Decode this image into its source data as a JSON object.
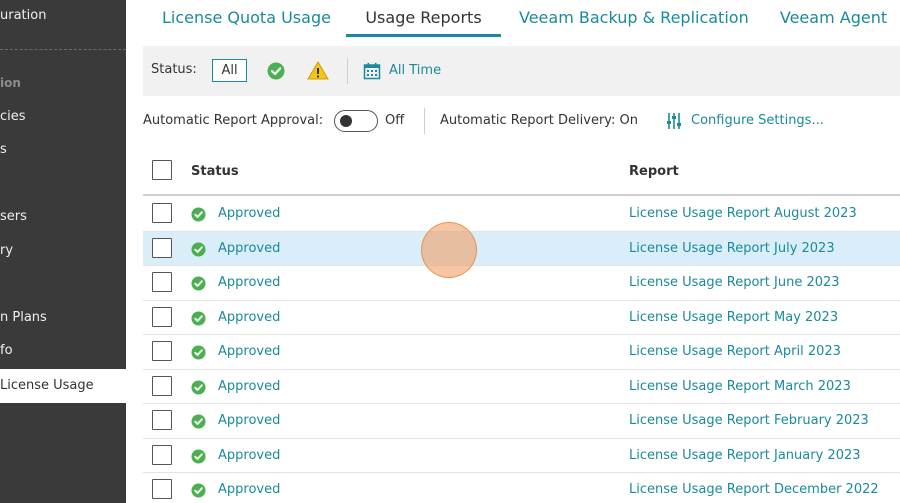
{
  "sidebar": {
    "items": [
      {
        "label": "uration"
      },
      {
        "label": "ion"
      },
      {
        "label": "cies"
      },
      {
        "label": "s"
      },
      {
        "label": "sers"
      },
      {
        "label": "ry"
      },
      {
        "label": "n Plans"
      },
      {
        "label": "fo"
      },
      {
        "label": "License Usage"
      }
    ]
  },
  "tabs": [
    {
      "label": "License Quota Usage"
    },
    {
      "label": "Usage Reports"
    },
    {
      "label": "Veeam Backup & Replication"
    },
    {
      "label": "Veeam Agent"
    }
  ],
  "filter": {
    "status_label": "Status:",
    "all_label": "All",
    "time_label": "All Time"
  },
  "approval": {
    "label": "Automatic Report Approval:",
    "toggle_state": "Off",
    "delivery": "Automatic Report Delivery: On",
    "configure": "Configure Settings..."
  },
  "table": {
    "headers": {
      "status": "Status",
      "report": "Report"
    },
    "rows": [
      {
        "status": "Approved",
        "report": "License Usage Report August 2023"
      },
      {
        "status": "Approved",
        "report": "License Usage Report July 2023"
      },
      {
        "status": "Approved",
        "report": "License Usage Report June 2023"
      },
      {
        "status": "Approved",
        "report": "License Usage Report May 2023"
      },
      {
        "status": "Approved",
        "report": "License Usage Report April 2023"
      },
      {
        "status": "Approved",
        "report": "License Usage Report March 2023"
      },
      {
        "status": "Approved",
        "report": "License Usage Report February 2023"
      },
      {
        "status": "Approved",
        "report": "License Usage Report January 2023"
      },
      {
        "status": "Approved",
        "report": "License Usage Report December 2022"
      }
    ]
  },
  "colors": {
    "accent": "#1a8a9c",
    "sidebar_bg": "#3a3a3a",
    "selected_row": "#daeef9",
    "approved_green": "#4caf50",
    "warning_yellow": "#f5c518"
  },
  "icons": {
    "approved": "check-circle-icon",
    "warning": "warning-triangle-icon",
    "calendar": "calendar-icon",
    "settings": "sliders-icon"
  }
}
